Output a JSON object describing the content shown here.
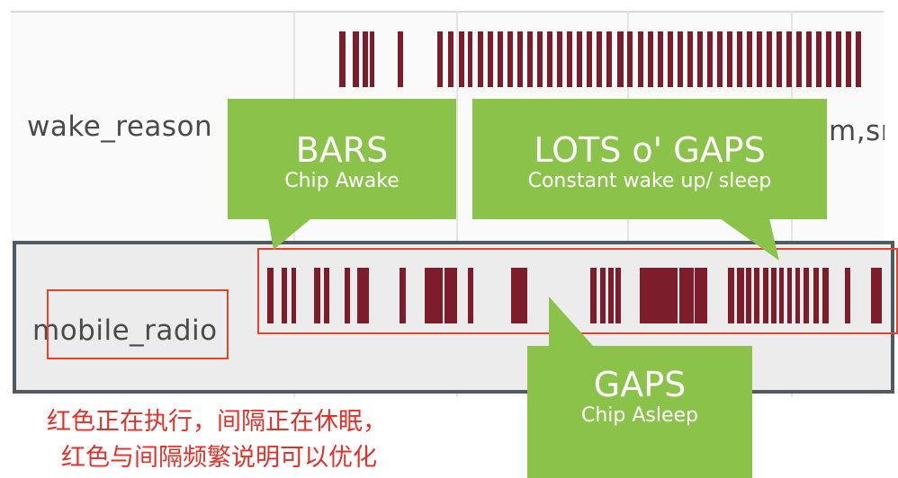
{
  "tracks": {
    "wake_reason_label": "wake_reason",
    "mobile_radio_label": "mobile_radio",
    "clipped_label": "m,sn"
  },
  "callouts": {
    "bars": {
      "title": "BARS",
      "subtitle": "Chip Awake"
    },
    "lots_of_gaps": {
      "title": "LOTS o' GAPS",
      "subtitle": "Constant wake up/ sleep"
    },
    "gaps": {
      "title": "GAPS",
      "subtitle": "Chip Asleep"
    }
  },
  "caption": {
    "line1": "红色正在执行，间隔正在休眠，",
    "line2": "红色与间隔频繁说明可以优化"
  },
  "colors": {
    "bar": "#7c1d2c",
    "callout": "#8bc34a",
    "annotation": "#e8412c",
    "caption": "#e0322a",
    "row_border": "#4f5b60"
  }
}
